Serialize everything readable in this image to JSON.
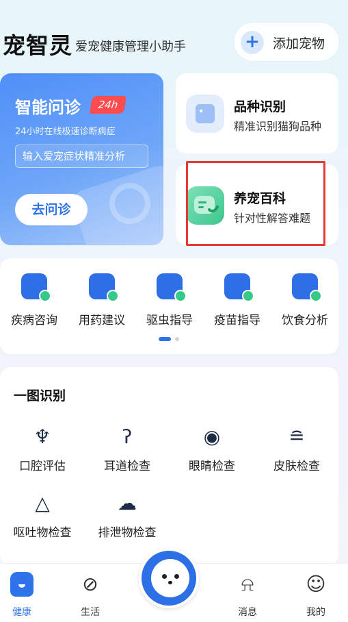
{
  "header": {
    "brand": "宠智灵",
    "slogan": "爱宠健康管理小助手",
    "add_pet_label": "添加宠物"
  },
  "consult": {
    "title": "智能问诊",
    "tag": "24h",
    "subtitle": "24小时在线极速诊断病症",
    "input_placeholder": "输入爱宠症状精准分析",
    "button_label": "去问诊"
  },
  "cards": {
    "breed": {
      "title": "品种识别",
      "subtitle": "精准识别猫狗品种"
    },
    "wiki": {
      "title": "养宠百科",
      "subtitle": "针对性解答难题"
    }
  },
  "quick_tools": [
    {
      "label": "疾病咨询",
      "icon": "disease-consult-icon"
    },
    {
      "label": "用药建议",
      "icon": "medicine-icon"
    },
    {
      "label": "驱虫指导",
      "icon": "deworm-icon"
    },
    {
      "label": "疫苗指导",
      "icon": "vaccine-icon"
    },
    {
      "label": "饮食分析",
      "icon": "diet-icon"
    }
  ],
  "scan": {
    "title": "一图识别",
    "items": [
      {
        "label": "口腔评估",
        "icon": "tooth-icon",
        "glyph": "♆"
      },
      {
        "label": "耳道检查",
        "icon": "ear-icon",
        "glyph": "ʔ"
      },
      {
        "label": "眼睛检查",
        "icon": "eye-icon",
        "glyph": "◉"
      },
      {
        "label": "皮肤检查",
        "icon": "skin-icon",
        "glyph": "≘"
      },
      {
        "label": "呕吐物检查",
        "icon": "vomit-icon",
        "glyph": "△"
      },
      {
        "label": "排泄物检查",
        "icon": "poop-icon",
        "glyph": "☁"
      }
    ]
  },
  "tabbar": [
    {
      "label": "健康",
      "icon": "health-icon",
      "active": true
    },
    {
      "label": "生活",
      "icon": "planet-icon",
      "glyph": "⊘"
    },
    {
      "label": "消息",
      "icon": "bell-icon",
      "glyph": "⍾"
    },
    {
      "label": "我的",
      "icon": "smile-icon",
      "glyph": "☺"
    }
  ],
  "colors": {
    "primary": "#2f73e8",
    "accent_green": "#35c98a",
    "tag_red": "#ff4d4f"
  }
}
